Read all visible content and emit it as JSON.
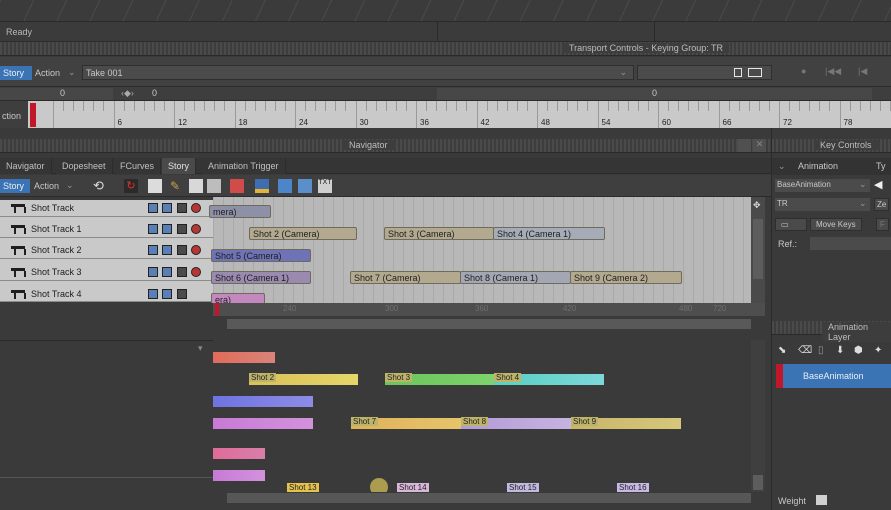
{
  "status": {
    "text": "Ready"
  },
  "transport": {
    "title": "Transport Controls  -  Keying Group: TR",
    "story_btn": "Story",
    "action_label": "Action",
    "take_label": "Take 001",
    "left_value": "0",
    "offset_value": "0",
    "right_value": "0",
    "row_label": "ction",
    "ruler_numbers": [
      "0",
      "6",
      "12",
      "18",
      "24",
      "30",
      "36",
      "42",
      "48",
      "54",
      "60",
      "66",
      "72",
      "78"
    ]
  },
  "navigator": {
    "title": "Navigator",
    "tabs": [
      {
        "label": "Navigator"
      },
      {
        "label": "Dopesheet"
      },
      {
        "label": "FCurves"
      },
      {
        "label": "Story"
      },
      {
        "label": "Animation Trigger"
      }
    ],
    "toolbar": {
      "story_btn": "Story",
      "action_label": "Action"
    }
  },
  "tracks": [
    {
      "label": "Shot Track"
    },
    {
      "label": "Shot Track 1"
    },
    {
      "label": "Shot Track 2"
    },
    {
      "label": "Shot Track 3"
    },
    {
      "label": "Shot Track 4"
    }
  ],
  "clips": {
    "c1": "mera)",
    "c2": "Shot 2 (Camera)",
    "c3": "Shot 3 (Camera)",
    "c4": "Shot 4 (Camera 1)",
    "c5": "Shot 5 (Camera)",
    "c6": "Shot 6 (Camera 1)",
    "c7": "Shot 7 (Camera)",
    "c8": "Shot 8 (Camera 1)",
    "c9": "Shot 9 (Camera 2)",
    "c10": "era)"
  },
  "timeline_numbers": [
    "240",
    "300",
    "360",
    "420",
    "480",
    "720",
    "840"
  ],
  "shots": [
    {
      "label": "Shot 2"
    },
    {
      "label": "Shot 3"
    },
    {
      "label": "Shot 4"
    },
    {
      "label": "Shot 7"
    },
    {
      "label": "Shot 8"
    },
    {
      "label": "Shot 9"
    },
    {
      "label": "Shot 13"
    },
    {
      "label": "Shot 14"
    },
    {
      "label": "Shot 15"
    },
    {
      "label": "Shot 16"
    }
  ],
  "key_controls": {
    "title": "Key Controls",
    "animation_tab": "Animation",
    "type_tab": "Ty",
    "layer_select": "BaseAnimation",
    "group_select": "TR",
    "zero_btn": "Ze",
    "move_keys_btn": "Move Keys",
    "f_btn": "F",
    "ref_label": "Ref.:"
  },
  "animation_layers": {
    "title": "Animation Layer",
    "layer_name": "BaseAnimation",
    "weight_label": "Weight"
  },
  "colors": {
    "accent": "#3a74b5",
    "marker": "#c0182a",
    "bg": "#3a3a3a"
  }
}
